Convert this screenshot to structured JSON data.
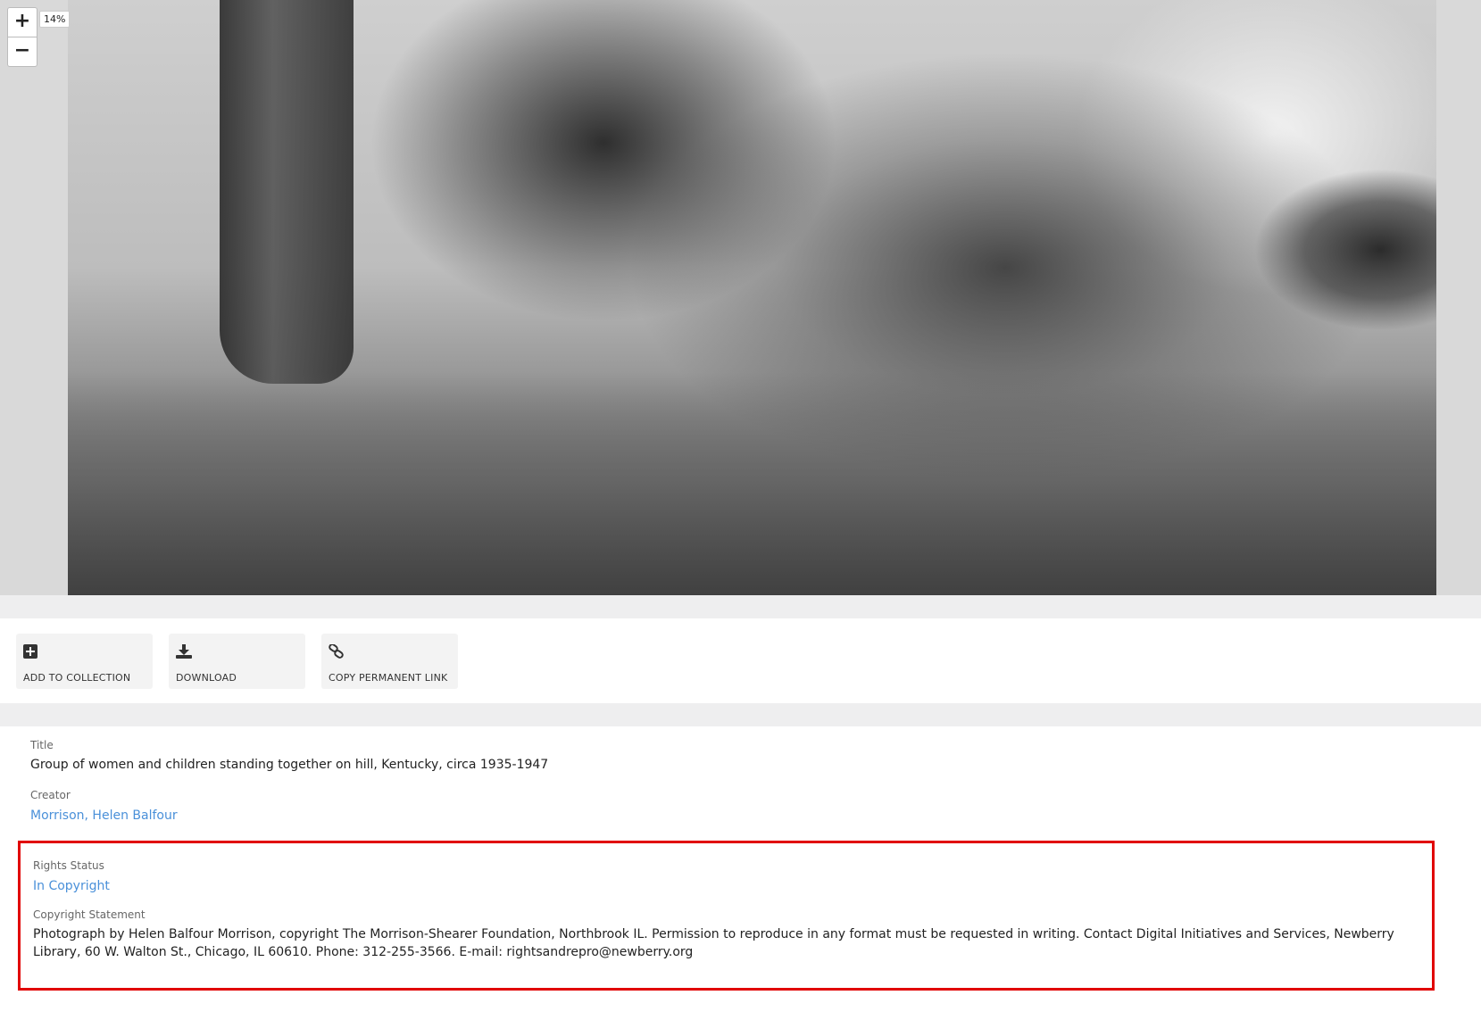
{
  "viewer": {
    "zoom_in": "+",
    "zoom_out": "−",
    "zoom_level": "14%"
  },
  "toolbar": {
    "add_to_collection": "ADD TO COLLECTION",
    "download": "DOWNLOAD",
    "copy_permanent_link": "COPY PERMANENT LINK"
  },
  "metadata": {
    "title_label": "Title",
    "title_value": "Group of women and children standing together on hill, Kentucky, circa 1935-1947",
    "creator_label": "Creator",
    "creator_value": "Morrison, Helen Balfour",
    "rights_status_label": "Rights Status",
    "rights_status_value": "In Copyright",
    "copyright_label": "Copyright Statement",
    "copyright_value": "Photograph by Helen Balfour Morrison, copyright The Morrison-Shearer Foundation, Northbrook IL. Permission to reproduce in any format must be requested in writing. Contact Digital Initiatives and Services, Newberry Library, 60 W. Walton St., Chicago, IL 60610. Phone: 312-255-3566. E-mail: rightsandrepro@newberry.org"
  },
  "colors": {
    "link": "#4a90d9",
    "highlight_border": "#e10000"
  },
  "icons": [
    "plus-square-icon",
    "download-icon",
    "link-icon"
  ]
}
